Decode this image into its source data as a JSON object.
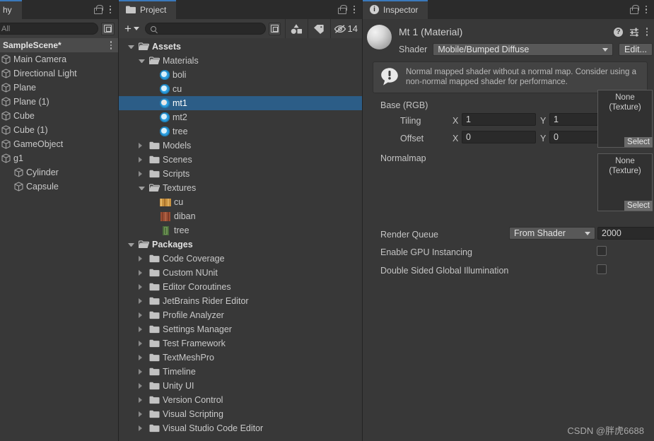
{
  "hierarchy": {
    "tab_label": "hy",
    "search_placeholder": "All",
    "search_value": "",
    "scene_name": "SampleScene*",
    "items": [
      {
        "label": "Main Camera",
        "indent": 0,
        "icon": "gameobject-cube-icon"
      },
      {
        "label": "Directional Light",
        "indent": 0,
        "icon": "gameobject-cube-icon"
      },
      {
        "label": "Plane",
        "indent": 0,
        "icon": "gameobject-cube-icon"
      },
      {
        "label": "Plane (1)",
        "indent": 0,
        "icon": "gameobject-cube-icon"
      },
      {
        "label": "Cube",
        "indent": 0,
        "icon": "gameobject-cube-icon"
      },
      {
        "label": "Cube (1)",
        "indent": 0,
        "icon": "gameobject-cube-icon"
      },
      {
        "label": "GameObject",
        "indent": 0,
        "icon": "gameobject-cube-icon"
      },
      {
        "label": "g1",
        "indent": 0,
        "icon": "gameobject-cube-icon"
      },
      {
        "label": "Cylinder",
        "indent": 1,
        "icon": "gameobject-cube-icon"
      },
      {
        "label": "Capsule",
        "indent": 1,
        "icon": "gameobject-cube-icon"
      }
    ]
  },
  "project": {
    "tab_label": "Project",
    "search_placeholder": "",
    "search_value": "",
    "hidden_count": "14",
    "tree": [
      {
        "label": "Assets",
        "indent": 0,
        "arrow": "down",
        "icon": "folder-open-icon",
        "bold": true,
        "selected": false
      },
      {
        "label": "Materials",
        "indent": 1,
        "arrow": "down",
        "icon": "folder-open-icon",
        "bold": false,
        "selected": false
      },
      {
        "label": "boli",
        "indent": 2,
        "arrow": "none",
        "icon": "material-ball-icon",
        "bold": false,
        "selected": false
      },
      {
        "label": "cu",
        "indent": 2,
        "arrow": "none",
        "icon": "material-ball-icon",
        "bold": false,
        "selected": false
      },
      {
        "label": "mt1",
        "indent": 2,
        "arrow": "none",
        "icon": "material-ball-icon",
        "bold": false,
        "selected": true
      },
      {
        "label": "mt2",
        "indent": 2,
        "arrow": "none",
        "icon": "material-ball-icon",
        "bold": false,
        "selected": false
      },
      {
        "label": "tree",
        "indent": 2,
        "arrow": "none",
        "icon": "material-ball-icon",
        "bold": false,
        "selected": false
      },
      {
        "label": "Models",
        "indent": 1,
        "arrow": "right",
        "icon": "folder-icon",
        "bold": false,
        "selected": false
      },
      {
        "label": "Scenes",
        "indent": 1,
        "arrow": "right",
        "icon": "folder-icon",
        "bold": false,
        "selected": false
      },
      {
        "label": "Scripts",
        "indent": 1,
        "arrow": "right",
        "icon": "folder-icon",
        "bold": false,
        "selected": false
      },
      {
        "label": "Textures",
        "indent": 1,
        "arrow": "down",
        "icon": "folder-open-icon",
        "bold": false,
        "selected": false
      },
      {
        "label": "cu",
        "indent": 2,
        "arrow": "none",
        "icon": "texture-cu-icon",
        "bold": false,
        "selected": false
      },
      {
        "label": "diban",
        "indent": 2,
        "arrow": "none",
        "icon": "texture-diban-icon",
        "bold": false,
        "selected": false
      },
      {
        "label": "tree",
        "indent": 2,
        "arrow": "none",
        "icon": "texture-tree-icon",
        "bold": false,
        "selected": false
      },
      {
        "label": "Packages",
        "indent": 0,
        "arrow": "down",
        "icon": "folder-open-icon",
        "bold": true,
        "selected": false
      },
      {
        "label": "Code Coverage",
        "indent": 1,
        "arrow": "right",
        "icon": "folder-icon",
        "bold": false,
        "selected": false
      },
      {
        "label": "Custom NUnit",
        "indent": 1,
        "arrow": "right",
        "icon": "folder-icon",
        "bold": false,
        "selected": false
      },
      {
        "label": "Editor Coroutines",
        "indent": 1,
        "arrow": "right",
        "icon": "folder-icon",
        "bold": false,
        "selected": false
      },
      {
        "label": "JetBrains Rider Editor",
        "indent": 1,
        "arrow": "right",
        "icon": "folder-icon",
        "bold": false,
        "selected": false
      },
      {
        "label": "Profile Analyzer",
        "indent": 1,
        "arrow": "right",
        "icon": "folder-icon",
        "bold": false,
        "selected": false
      },
      {
        "label": "Settings Manager",
        "indent": 1,
        "arrow": "right",
        "icon": "folder-icon",
        "bold": false,
        "selected": false
      },
      {
        "label": "Test Framework",
        "indent": 1,
        "arrow": "right",
        "icon": "folder-icon",
        "bold": false,
        "selected": false
      },
      {
        "label": "TextMeshPro",
        "indent": 1,
        "arrow": "right",
        "icon": "folder-icon",
        "bold": false,
        "selected": false
      },
      {
        "label": "Timeline",
        "indent": 1,
        "arrow": "right",
        "icon": "folder-icon",
        "bold": false,
        "selected": false
      },
      {
        "label": "Unity UI",
        "indent": 1,
        "arrow": "right",
        "icon": "folder-icon",
        "bold": false,
        "selected": false
      },
      {
        "label": "Version Control",
        "indent": 1,
        "arrow": "right",
        "icon": "folder-icon",
        "bold": false,
        "selected": false
      },
      {
        "label": "Visual Scripting",
        "indent": 1,
        "arrow": "right",
        "icon": "folder-icon",
        "bold": false,
        "selected": false
      },
      {
        "label": "Visual Studio Code Editor",
        "indent": 1,
        "arrow": "right",
        "icon": "folder-icon",
        "bold": false,
        "selected": false
      }
    ]
  },
  "inspector": {
    "tab_label": "Inspector",
    "material_title": "Mt 1 (Material)",
    "shader_label": "Shader",
    "shader_value": "Mobile/Bumped Diffuse",
    "edit_label": "Edit...",
    "warning_text": "Normal mapped shader without a normal map. Consider using a non-normal mapped shader for performance.",
    "base_label": "Base (RGB)",
    "tiling_label": "Tiling",
    "offset_label": "Offset",
    "x_label": "X",
    "y_label": "Y",
    "tiling_x": "1",
    "tiling_y": "1",
    "offset_x": "0",
    "offset_y": "0",
    "normalmap_label": "Normalmap",
    "texture_none_line1": "None",
    "texture_none_line2": "(Texture)",
    "select_label": "Select",
    "render_queue_label": "Render Queue",
    "render_queue_value": "From Shader",
    "render_queue_number": "2000",
    "gpu_instancing_label": "Enable GPU Instancing",
    "gpu_instancing_checked": false,
    "double_sided_label": "Double Sided Global Illumination",
    "double_sided_checked": false
  },
  "watermark": "CSDN @胖虎6688",
  "colors": {
    "panel_bg": "#383838",
    "tabbar_bg": "#2b2b2b",
    "tab_active_bg": "#3c3c3c",
    "tab_accent": "#3a79bb",
    "selection_blue": "#2c5d87",
    "field_bg": "#2a2a2a",
    "button_bg": "#585858",
    "material_ball": "#2f9fe0"
  }
}
